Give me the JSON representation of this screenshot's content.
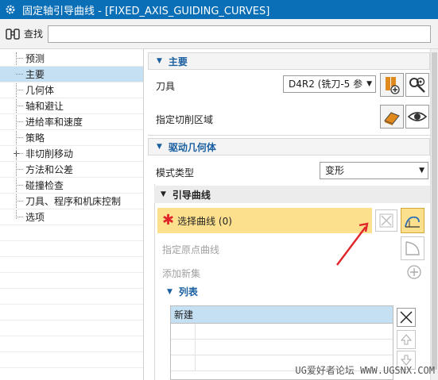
{
  "window": {
    "title": "固定轴引导曲线 - [FIXED_AXIS_GUIDING_CURVES]"
  },
  "search": {
    "label": "查找",
    "value": ""
  },
  "tree": {
    "items": [
      {
        "label": "预测",
        "selected": false
      },
      {
        "label": "主要",
        "selected": true
      },
      {
        "label": "几何体",
        "selected": false
      },
      {
        "label": "轴和避让",
        "selected": false
      },
      {
        "label": "进给率和速度",
        "selected": false
      },
      {
        "label": "策略",
        "selected": false
      },
      {
        "label": "非切削移动",
        "selected": false,
        "expander": "+"
      },
      {
        "label": "方法和公差",
        "selected": false
      },
      {
        "label": "碰撞检查",
        "selected": false
      },
      {
        "label": "刀具、程序和机床控制",
        "selected": false
      },
      {
        "label": "选项",
        "selected": false
      }
    ]
  },
  "main": {
    "section_title": "主要",
    "tool_label": "刀具",
    "tool_value": "D4R2 (铣刀-5 参",
    "cut_region_label": "指定切削区域"
  },
  "drive": {
    "section_title": "驱动几何体",
    "mode_label": "模式类型",
    "mode_value": "变形",
    "guide": {
      "title": "引导曲线",
      "select_label": "选择曲线 (0)",
      "origin_label": "指定原点曲线",
      "add_set_label": "添加新集",
      "list_title": "列表",
      "list_header": "新建"
    }
  },
  "watermark": "UG爱好者论坛 WWW.UGSNX.COM",
  "colors": {
    "title_bar": "#0b6fb8",
    "selection_highlight": "#c5dff3",
    "active_row": "#fce08e",
    "required_star": "#e0262b",
    "section_text": "#1a5fa0",
    "annotation_arrow": "#e0262b"
  },
  "icons": {
    "title": "gear-icon",
    "search": "binoculars-icon",
    "tool_new": "new-tool-icon",
    "tool_edit": "edit-tool-icon",
    "region_select": "select-face-icon",
    "display": "eye-icon",
    "select_curve": "curve-select-icon",
    "origin_curve": "origin-curve-icon",
    "add_set": "add-icon",
    "delete": "delete-icon",
    "move_up": "move-up-icon",
    "move_down": "move-down-icon"
  }
}
